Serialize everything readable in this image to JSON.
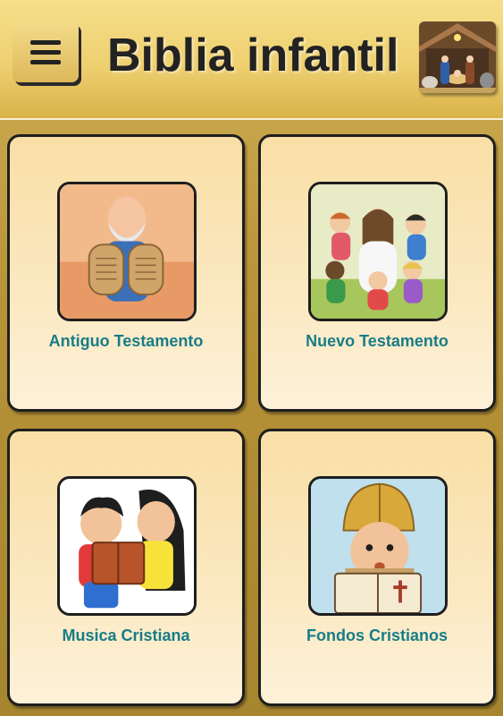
{
  "header": {
    "title": "Biblia infantil",
    "menu_icon": "hamburger-menu-icon",
    "image": "nativity-scene-image"
  },
  "menu": [
    {
      "label": "Antiguo Testamento",
      "image": "moses-tablets-image"
    },
    {
      "label": "Nuevo Testamento",
      "image": "jesus-children-image"
    },
    {
      "label": "Musica Cristiana",
      "image": "children-reading-image"
    },
    {
      "label": "Fondos Cristianos",
      "image": "soldier-reading-image"
    }
  ],
  "colors": {
    "label": "#187d86",
    "card_top": "#f9dfa6",
    "card_bottom": "#fdf1d8",
    "header": "#eed070",
    "background": "#b89338"
  }
}
